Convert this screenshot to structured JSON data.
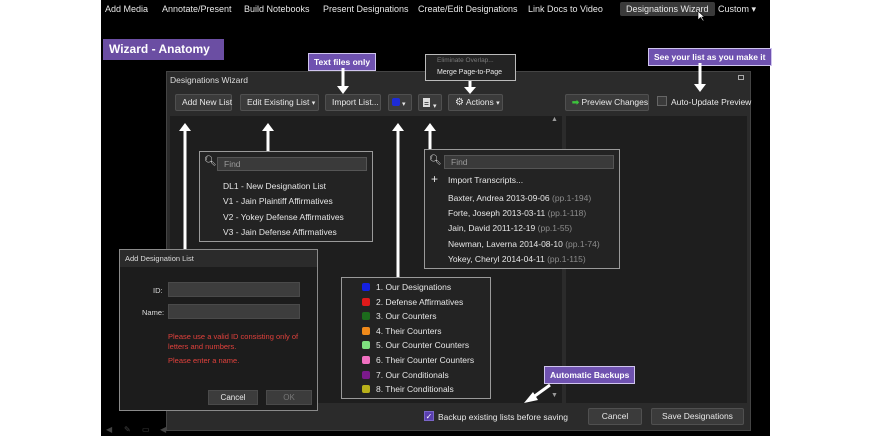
{
  "menu": {
    "items": [
      "Add Media",
      "Annotate/Present",
      "Build Notebooks",
      "Present Designations",
      "Create/Edit Designations",
      "Link Docs to Video",
      "Designations Wizard",
      "Custom"
    ],
    "active_index": 6
  },
  "page_title": "Wizard - Anatomy",
  "callouts": {
    "text_files_only": "Text files only",
    "see_your_list": "See your list as you make it",
    "automatic_backups": "Automatic Backups"
  },
  "dialog": {
    "title": "Designations Wizard",
    "toolbar": {
      "add_new_list": "Add New List",
      "edit_existing_list": "Edit Existing List",
      "import_list": "Import List...",
      "actions": "Actions",
      "preview_changes": "Preview Changes",
      "auto_update_preview": "Auto-Update Preview",
      "color_swatch": "#1d2bd6"
    },
    "actions_menu": {
      "items": [
        "Eliminate Overlap...",
        "Merge Page-to-Page"
      ]
    },
    "footer": {
      "backup_label": "Backup existing lists before saving",
      "backup_checked": true,
      "cancel": "Cancel",
      "save": "Save Designations"
    }
  },
  "edit_list_panel": {
    "find_placeholder": "Find",
    "items": [
      "DL1 - New Designation List",
      "V1 - Jain Plaintiff Affirmatives",
      "V2 - Yokey Defense Affirmatives",
      "V3 - Jain Defense Affirmatives"
    ]
  },
  "import_panel": {
    "find_placeholder": "Find",
    "import_transcripts": "Import Transcripts...",
    "transcripts": [
      {
        "name": "Baxter, Andrea 2013-09-06",
        "pages": "(pp.1-194)"
      },
      {
        "name": "Forte, Joseph 2013-03-11",
        "pages": "(pp.1-118)"
      },
      {
        "name": "Jain, David 2011-12-19",
        "pages": "(pp.1-55)"
      },
      {
        "name": "Newman, Laverna 2014-08-10",
        "pages": "(pp.1-74)"
      },
      {
        "name": "Yokey, Cheryl 2014-04-11",
        "pages": "(pp.1-115)"
      }
    ]
  },
  "color_panel": {
    "items": [
      {
        "label": "1. Our Designations",
        "color": "#1420e0"
      },
      {
        "label": "2. Defense Affirmatives",
        "color": "#e01a1a"
      },
      {
        "label": "3. Our Counters",
        "color": "#1c6b1c"
      },
      {
        "label": "4. Their Counters",
        "color": "#f08a1a"
      },
      {
        "label": "5. Our Counter Counters",
        "color": "#7ee07e"
      },
      {
        "label": "6. Their Counter Counters",
        "color": "#f070c0"
      },
      {
        "label": "7. Our Conditionals",
        "color": "#7a1a8a"
      },
      {
        "label": "8. Their Conditionals",
        "color": "#b8b01a"
      }
    ]
  },
  "add_designation_dialog": {
    "title": "Add Designation List",
    "id_label": "ID:",
    "name_label": "Name:",
    "error_id": "Please use a valid ID consisting only of letters and numbers.",
    "error_name": "Please enter a name.",
    "cancel": "Cancel",
    "ok": "OK"
  }
}
